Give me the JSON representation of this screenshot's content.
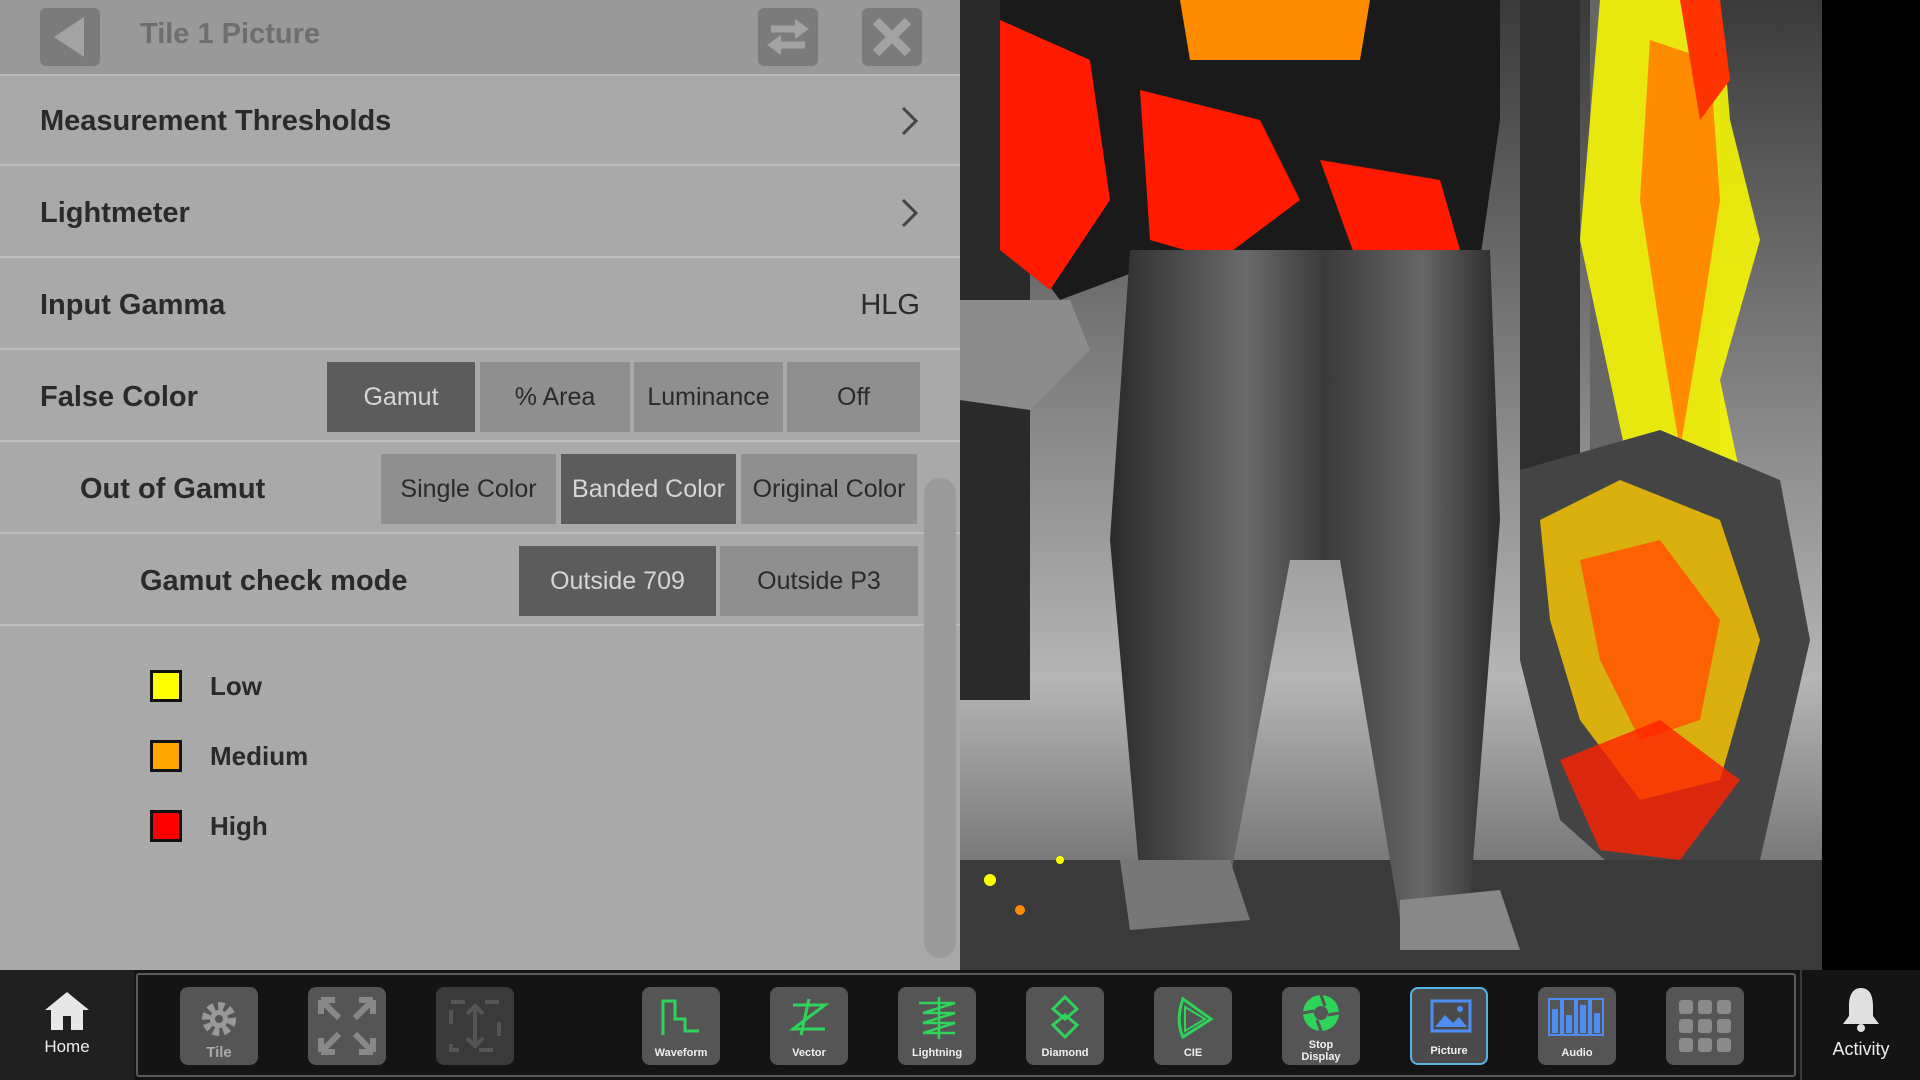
{
  "panel": {
    "title": "Tile 1 Picture",
    "rows": {
      "measurement_thresholds": "Measurement Thresholds",
      "lightmeter": "Lightmeter",
      "input_gamma_label": "Input Gamma",
      "input_gamma_value": "HLG",
      "false_color_label": "False Color",
      "out_of_gamut_label": "Out of Gamut",
      "gamut_check_label": "Gamut check mode"
    },
    "false_color_options": [
      "Gamut",
      "% Area",
      "Luminance",
      "Off"
    ],
    "false_color_selected": "Gamut",
    "out_of_gamut_options": [
      "Single Color",
      "Banded Color",
      "Original Color"
    ],
    "out_of_gamut_selected": "Banded Color",
    "gamut_check_options": [
      "Outside 709",
      "Outside P3"
    ],
    "gamut_check_selected": "Outside 709",
    "legend": [
      {
        "label": "Low",
        "color": "#ffff00"
      },
      {
        "label": "Medium",
        "color": "#ffa500"
      },
      {
        "label": "High",
        "color": "#ff0000"
      }
    ]
  },
  "toolbar": {
    "home": "Home",
    "activity": "Activity",
    "tile": "Tile",
    "tools": [
      "Waveform",
      "Vector",
      "Lightning",
      "Diamond",
      "CIE",
      "Stop Display",
      "Picture",
      "Audio"
    ],
    "active_tool": "Picture",
    "accent_green": "#2fd35a",
    "accent_blue": "#4f8df5"
  }
}
